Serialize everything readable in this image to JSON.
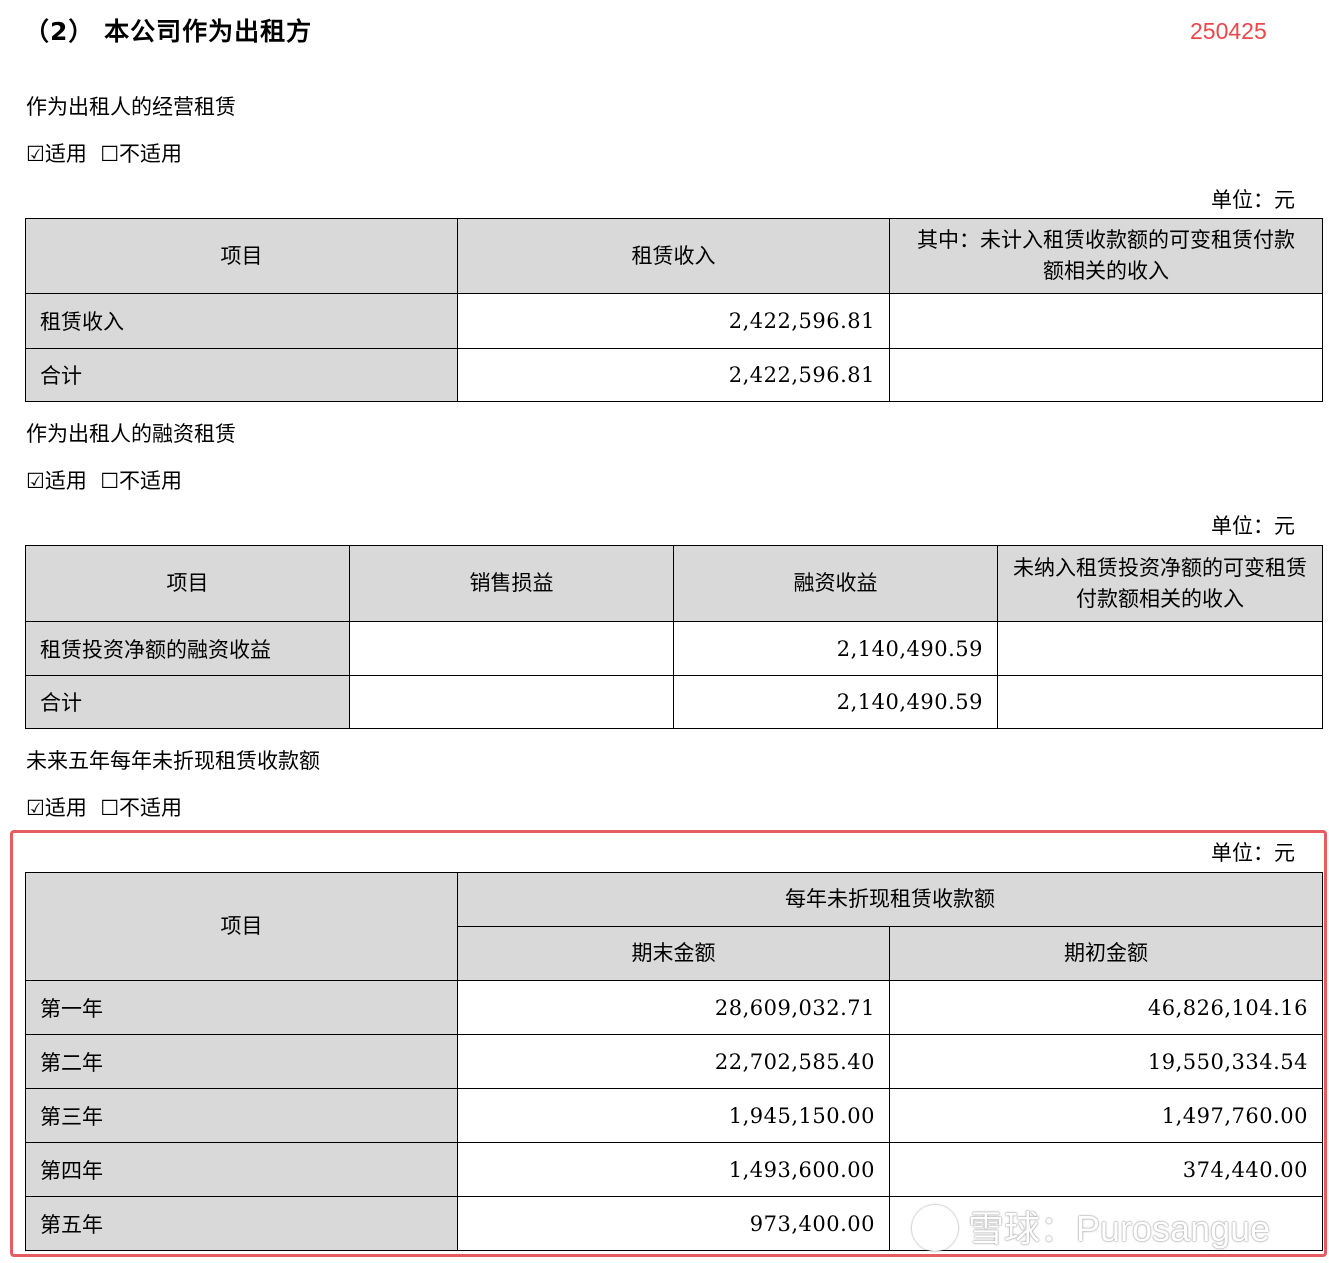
{
  "header": {
    "title": "（2） 本公司作为出租方",
    "code": "250425"
  },
  "applicability": {
    "checked": "☑适用",
    "unchecked": "☐不适用"
  },
  "unit": "单位：元",
  "operating_lease": {
    "label": "作为出租人的经营租赁",
    "headers": [
      "项目",
      "租赁收入",
      "其中：未计入租赁收款额的可变租赁付款额相关的收入"
    ],
    "rows": [
      {
        "item": "租赁收入",
        "income": "2,422,596.81",
        "variable": ""
      },
      {
        "item": "合计",
        "income": "2,422,596.81",
        "variable": ""
      }
    ]
  },
  "finance_lease": {
    "label": "作为出租人的融资租赁",
    "headers": [
      "项目",
      "销售损益",
      "融资收益",
      "未纳入租赁投资净额的可变租赁付款额相关的收入"
    ],
    "rows": [
      {
        "item": "租赁投资净额的融资收益",
        "sales": "",
        "finance": "2,140,490.59",
        "variable": ""
      },
      {
        "item": "合计",
        "sales": "",
        "finance": "2,140,490.59",
        "variable": ""
      }
    ]
  },
  "future_receipts": {
    "label": "未来五年每年未折现租赁收款额",
    "header_item": "项目",
    "header_group": "每年未折现租赁收款额",
    "header_end": "期末金额",
    "header_begin": "期初金额",
    "rows": [
      {
        "item": "第一年",
        "end": "28,609,032.71",
        "begin": "46,826,104.16"
      },
      {
        "item": "第二年",
        "end": "22,702,585.40",
        "begin": "19,550,334.54"
      },
      {
        "item": "第三年",
        "end": "1,945,150.00",
        "begin": "1,497,760.00"
      },
      {
        "item": "第四年",
        "end": "1,493,600.00",
        "begin": "374,440.00"
      },
      {
        "item": "第五年",
        "end": "973,400.00",
        "begin": ""
      }
    ]
  },
  "watermark": {
    "text": "雪球：Purosangue"
  }
}
